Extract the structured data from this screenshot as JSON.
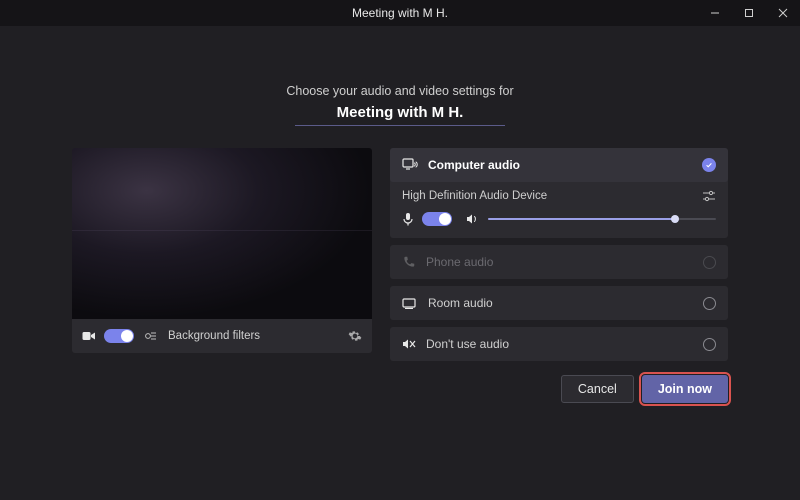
{
  "titlebar": {
    "title": "Meeting with M H."
  },
  "heading": {
    "line1": "Choose your audio and video settings for",
    "line2": "Meeting with M H."
  },
  "video": {
    "filters_label": "Background filters"
  },
  "audio": {
    "computer": {
      "label": "Computer audio",
      "device": "High Definition Audio Device",
      "volume_percent": 82
    },
    "phone": {
      "label": "Phone audio"
    },
    "room": {
      "label": "Room audio"
    },
    "none": {
      "label": "Don't use audio"
    }
  },
  "footer": {
    "cancel": "Cancel",
    "join": "Join now"
  },
  "colors": {
    "accent": "#6264a7"
  }
}
